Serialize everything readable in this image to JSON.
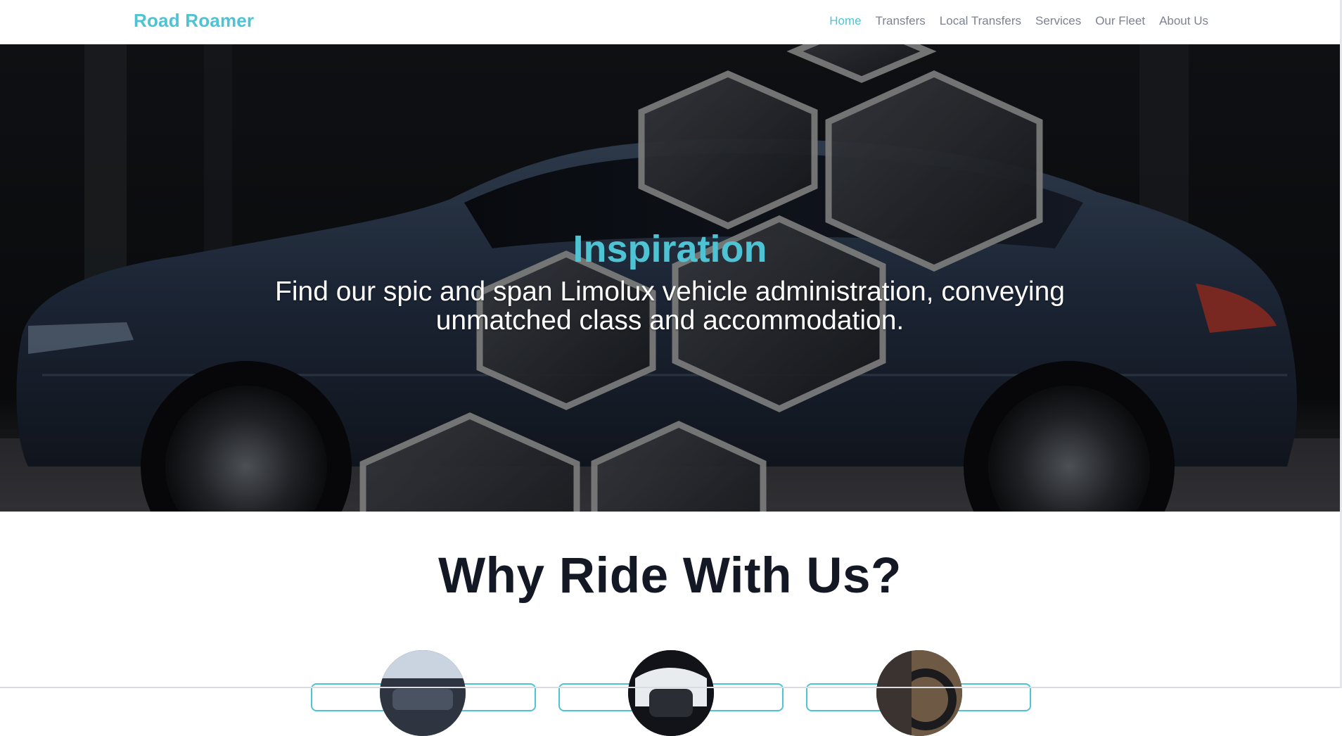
{
  "brand": {
    "name": "Road Roamer"
  },
  "nav": {
    "items": [
      {
        "label": "Home",
        "active": true
      },
      {
        "label": "Transfers",
        "active": false
      },
      {
        "label": "Local Transfers",
        "active": false
      },
      {
        "label": "Services",
        "active": false
      },
      {
        "label": "Our Fleet",
        "active": false
      },
      {
        "label": "About Us",
        "active": false
      }
    ]
  },
  "hero": {
    "title": "Inspiration",
    "subtitle": "Find our spic and span Limolux vehicle administration, conveying unmatched class and accommodation."
  },
  "section": {
    "title": "Why Ride With Us?"
  },
  "colors": {
    "accent": "#4ec3d3",
    "heading": "#141824",
    "nav_text": "#7b8290"
  }
}
